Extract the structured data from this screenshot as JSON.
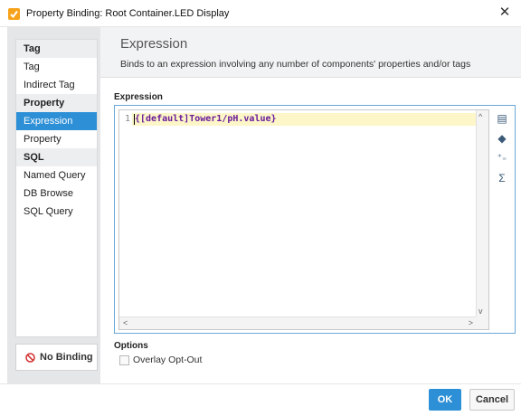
{
  "window": {
    "title": "Property Binding: Root Container.LED Display",
    "close_glyph": "✕"
  },
  "sidebar": {
    "groups": [
      {
        "header": "Tag",
        "items": [
          "Tag",
          "Indirect Tag"
        ]
      },
      {
        "header": "Property",
        "items": [
          "Expression",
          "Property"
        ]
      },
      {
        "header": "SQL",
        "items": [
          "Named Query",
          "DB Browse",
          "SQL Query"
        ]
      }
    ],
    "selected_item": "Expression",
    "no_binding_label": "No Binding"
  },
  "main": {
    "title": "Expression",
    "description": "Binds to an expression involving any number of components' properties and/or tags",
    "expression_label": "Expression",
    "editor": {
      "line_number": "1",
      "code": "{[default]Tower1/pH.value}"
    },
    "tools": [
      {
        "name": "property-icon",
        "glyph": "▤"
      },
      {
        "name": "tag-icon",
        "glyph": "◆"
      },
      {
        "name": "operator-icon",
        "glyph": "⁺₌"
      },
      {
        "name": "function-icon",
        "glyph": "Σ"
      }
    ],
    "options_label": "Options",
    "overlay_opt_out_label": "Overlay Opt-Out"
  },
  "footer": {
    "ok_label": "OK",
    "cancel_label": "Cancel"
  },
  "colors": {
    "accent": "#2d8fd6",
    "app_icon": "#f7a21b",
    "code_text": "#6a1b9a",
    "code_highlight": "#fdf6c8"
  }
}
